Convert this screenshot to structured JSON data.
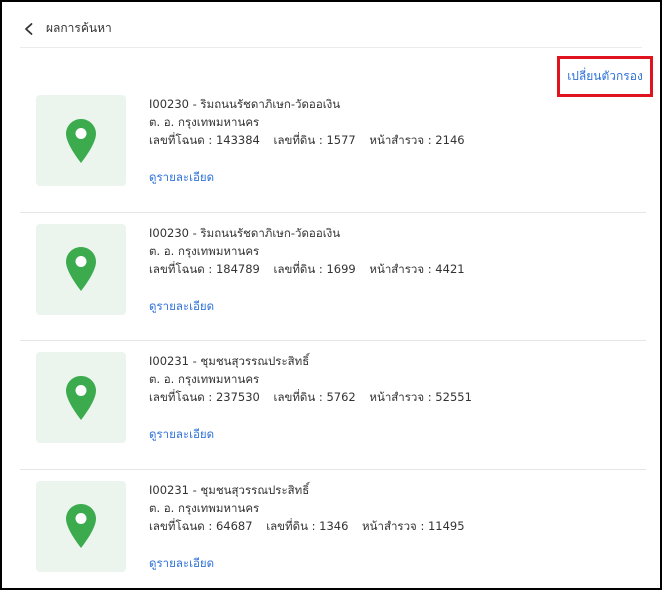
{
  "header": {
    "title": "ผลการค้นหา",
    "back_icon": "chevron-left-icon"
  },
  "filter": {
    "label": "เปลี่ยนตัวกรอง",
    "highlight_color": "#e0141e"
  },
  "colors": {
    "pin": "#3bab4e",
    "thumb_bg": "#ebf5ee",
    "link": "#2f72d9"
  },
  "results": [
    {
      "title": "I00230 - ริมถนนรัชดาภิเษก-วัดออเงิน",
      "location": "ต. อ. กรุงเทพมหานคร",
      "deed": "เลขที่โฉนด : 143384",
      "land": "เลขที่ดิน : 1577",
      "survey": "หน้าสำรวจ : 2146",
      "detail_label": "ดูรายละเอียด"
    },
    {
      "title": "I00230 - ริมถนนรัชดาภิเษก-วัดออเงิน",
      "location": "ต. อ. กรุงเทพมหานคร",
      "deed": "เลขที่โฉนด : 184789",
      "land": "เลขที่ดิน : 1699",
      "survey": "หน้าสำรวจ : 4421",
      "detail_label": "ดูรายละเอียด"
    },
    {
      "title": "I00231 - ชุมชนสุวรรณประสิทธิ์",
      "location": "ต. อ. กรุงเทพมหานคร",
      "deed": "เลขที่โฉนด : 237530",
      "land": "เลขที่ดิน : 5762",
      "survey": "หน้าสำรวจ : 52551",
      "detail_label": "ดูรายละเอียด"
    },
    {
      "title": "I00231 - ชุมชนสุวรรณประสิทธิ์",
      "location": "ต. อ. กรุงเทพมหานคร",
      "deed": "เลขที่โฉนด : 64687",
      "land": "เลขที่ดิน : 1346",
      "survey": "หน้าสำรวจ : 11495",
      "detail_label": "ดูรายละเอียด"
    }
  ]
}
